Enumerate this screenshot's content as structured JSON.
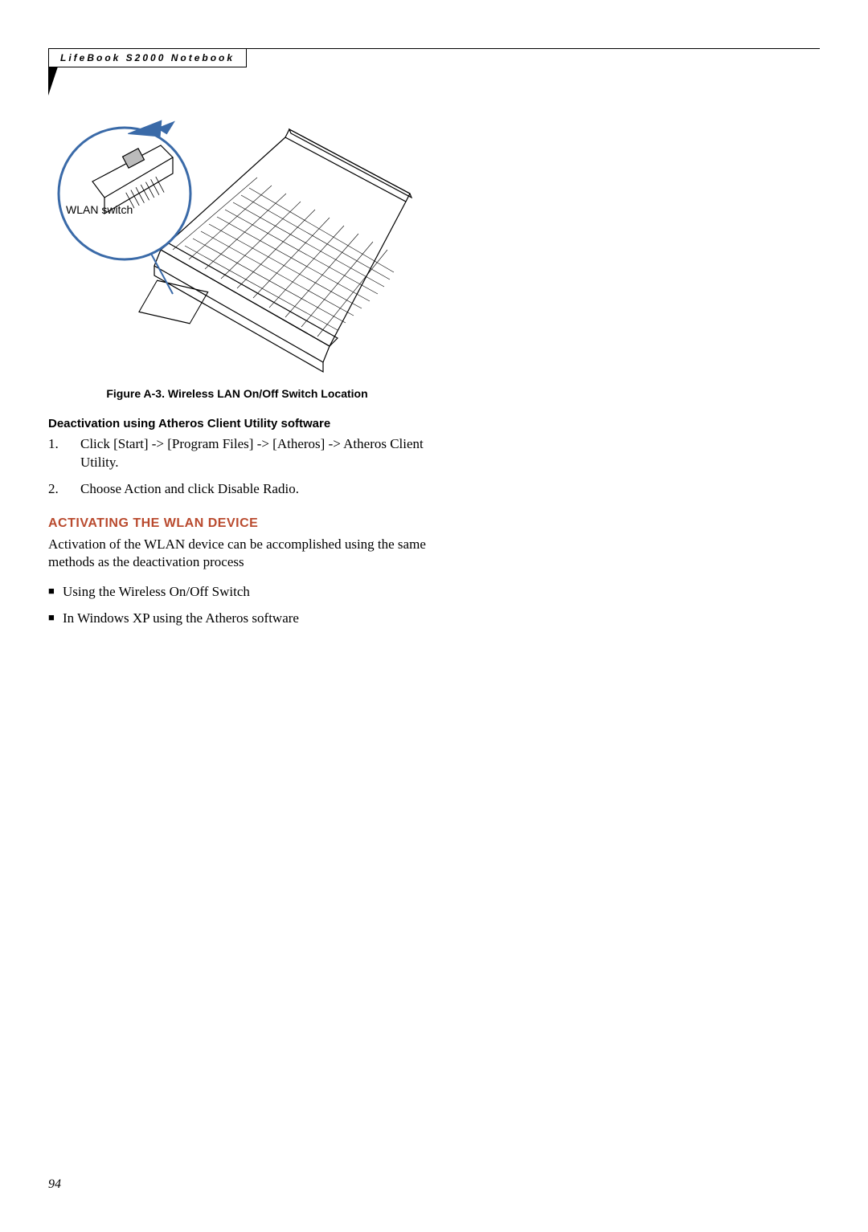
{
  "header": {
    "running_title": "LifeBook S2000 Notebook"
  },
  "figure": {
    "callout_label": "WLAN switch",
    "caption": "Figure A-3. Wireless LAN On/Off Switch Location"
  },
  "section1": {
    "heading": "Deactivation using Atheros Client Utility software",
    "items": [
      {
        "num": "1.",
        "text": "Click [Start] -> [Program Files] -> [Atheros] -> Atheros Client Utility."
      },
      {
        "num": "2.",
        "text": "Choose Action and click Disable Radio."
      }
    ]
  },
  "section2": {
    "heading": "ACTIVATING THE WLAN DEVICE",
    "para": "Activation of the WLAN device can be accomplished using the same methods as the deactivation process",
    "bullets": [
      "Using the Wireless On/Off Switch",
      "In Windows XP using the Atheros software"
    ]
  },
  "page_number": "94"
}
